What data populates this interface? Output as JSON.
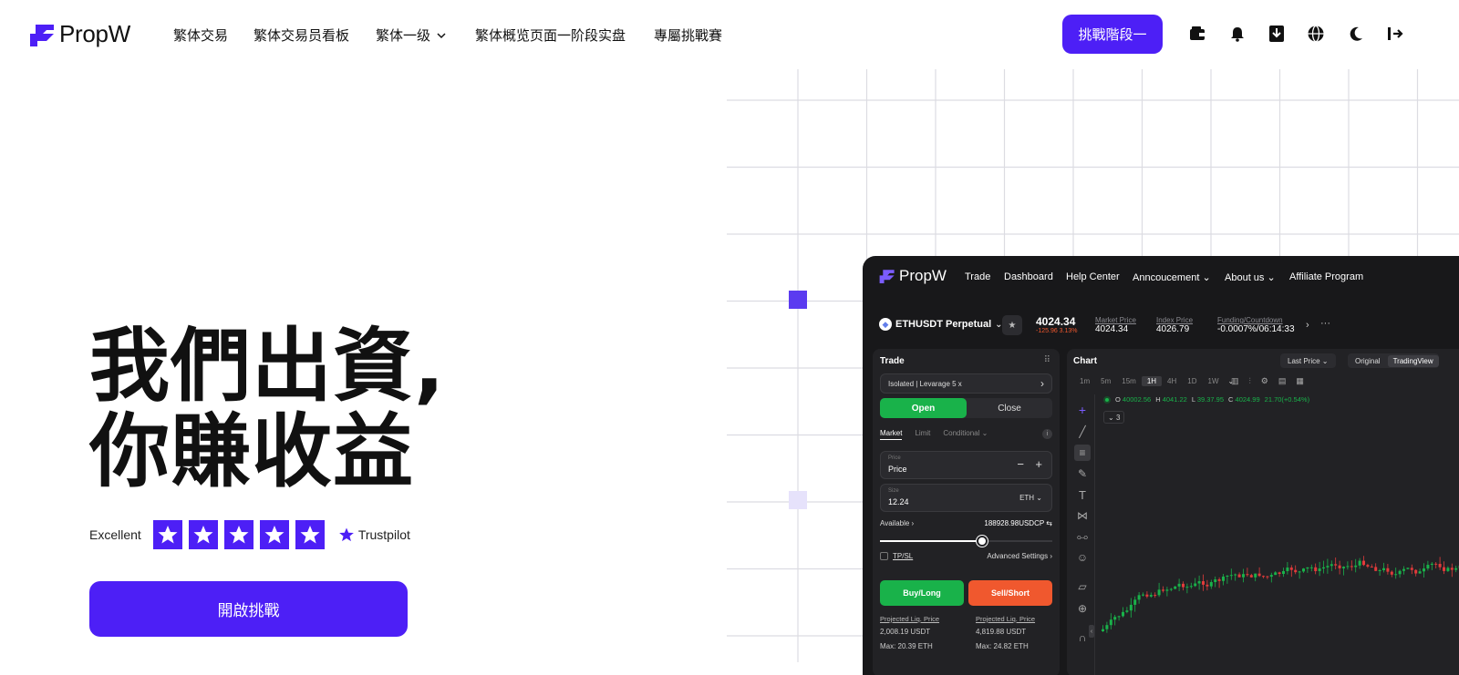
{
  "brand": {
    "name": "PropW",
    "accent": "#4d1ff6"
  },
  "nav": {
    "items": [
      "繁体交易",
      "繁体交易员看板",
      "繁体一级",
      "繁体概览页面一阶段实盘",
      "專屬挑戰賽"
    ],
    "cta": "挑戰階段一"
  },
  "header_icons": [
    "wallet-icon",
    "bell-icon",
    "download-icon",
    "globe-icon",
    "moon-icon",
    "logout-icon"
  ],
  "hero": {
    "line1": "我們出資,",
    "line2": "你賺收益",
    "rating_label": "Excellent",
    "rating_stars": 5,
    "trustpilot": "Trustpilot",
    "cta": "開啟挑戰"
  },
  "app": {
    "brand": "PropW",
    "nav": [
      "Trade",
      "Dashboard",
      "Help Center",
      "Anncoucement",
      "About us",
      "Affiliate Program"
    ],
    "symbol": "ETHUSDT Perpetual",
    "last_price": "4024.34",
    "change": "-125.96 3.13%",
    "market_price_label": "Market Price",
    "market_price": "4024.34",
    "index_price_label": "Index Price",
    "index_price": "4026.79",
    "funding_label": "Funding/Countdown",
    "funding": "-0.0007%/06:14:33",
    "trade": {
      "title": "Trade",
      "margin": "Isolated | Levarage 5 x",
      "open": "Open",
      "close": "Close",
      "order_tabs": [
        "Market",
        "Limit",
        "Conditional"
      ],
      "price_small": "Price",
      "price": "Price",
      "size_small": "Size",
      "size": "12.24",
      "size_unit": "ETH",
      "available_label": "Available",
      "available": "188928.98USDCP",
      "tpsl": "TP/SL",
      "advanced": "Advanced Settings",
      "buy": "Buy/Long",
      "sell": "Sell/Short",
      "liq_label": "Projected Liq. Price",
      "liq_buy": "2,008.19  USDT",
      "liq_sell": "4,819.88  USDT",
      "max_buy": "Max: 20.39 ETH",
      "max_sell": "Max: 24.82 ETH"
    },
    "chart": {
      "title": "Chart",
      "price_mode": "Last Price",
      "view_tabs": [
        "Original",
        "TradingView"
      ],
      "intervals": [
        "1m",
        "5m",
        "15m",
        "1H",
        "4H",
        "1D",
        "1W"
      ],
      "ohlc": {
        "o": "40002.56",
        "h": "4041.22",
        "l": "39.37.95",
        "c": "4024.99",
        "chg": "21.70(+0.54%)"
      },
      "indicator_count": "3"
    }
  }
}
